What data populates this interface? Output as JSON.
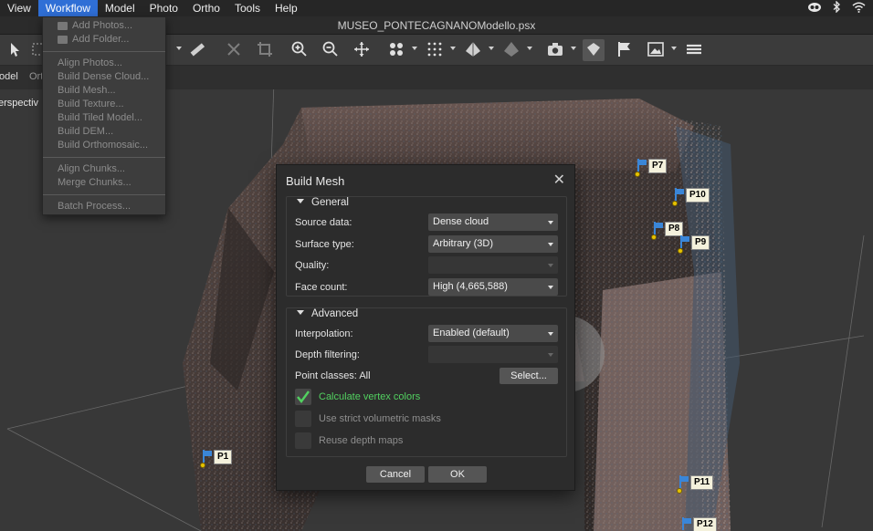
{
  "menubar": {
    "items": [
      "View",
      "Workflow",
      "Model",
      "Photo",
      "Ortho",
      "Tools",
      "Help"
    ],
    "active": "Workflow"
  },
  "titlebar": {
    "title": "MUSEO_PONTECAGNANOModello.psx"
  },
  "tabs": {
    "model": "odel",
    "ortho": "Ort"
  },
  "viewport": {
    "view_label": "erspectiv",
    "markers": [
      "P1",
      "P7",
      "P8",
      "P9",
      "P10",
      "P11",
      "P12"
    ]
  },
  "workflow_menu": {
    "add_photos": "Add Photos...",
    "add_folder": "Add Folder...",
    "align_photos": "Align Photos...",
    "build_dense_cloud": "Build Dense Cloud...",
    "build_mesh": "Build Mesh...",
    "build_texture": "Build Texture...",
    "build_tiled_model": "Build Tiled Model...",
    "build_dem": "Build DEM...",
    "build_orthomosaic": "Build Orthomosaic...",
    "align_chunks": "Align Chunks...",
    "merge_chunks": "Merge Chunks...",
    "batch_process": "Batch Process..."
  },
  "dialog": {
    "title": "Build Mesh",
    "close": "✕",
    "general": {
      "header": "General",
      "source_data_label": "Source data:",
      "source_data_value": "Dense cloud",
      "surface_type_label": "Surface type:",
      "surface_type_value": "Arbitrary (3D)",
      "quality_label": "Quality:",
      "quality_value": "",
      "face_count_label": "Face count:",
      "face_count_value": "High (4,665,588)"
    },
    "advanced": {
      "header": "Advanced",
      "interpolation_label": "Interpolation:",
      "interpolation_value": "Enabled (default)",
      "depth_filtering_label": "Depth filtering:",
      "depth_filtering_value": "",
      "point_classes_label": "Point classes:  All",
      "select_button": "Select...",
      "vertex_colors": "Calculate vertex colors",
      "vertex_colors_checked": true,
      "strict_masks": "Use strict volumetric masks",
      "strict_masks_checked": false,
      "reuse_depth": "Reuse depth maps",
      "reuse_depth_checked": false
    },
    "cancel": "Cancel",
    "ok": "OK"
  },
  "colors": {
    "menu_highlight": "#2f6fd6",
    "marker_flag": "#3a86d8",
    "checked_label": "#52d160"
  }
}
